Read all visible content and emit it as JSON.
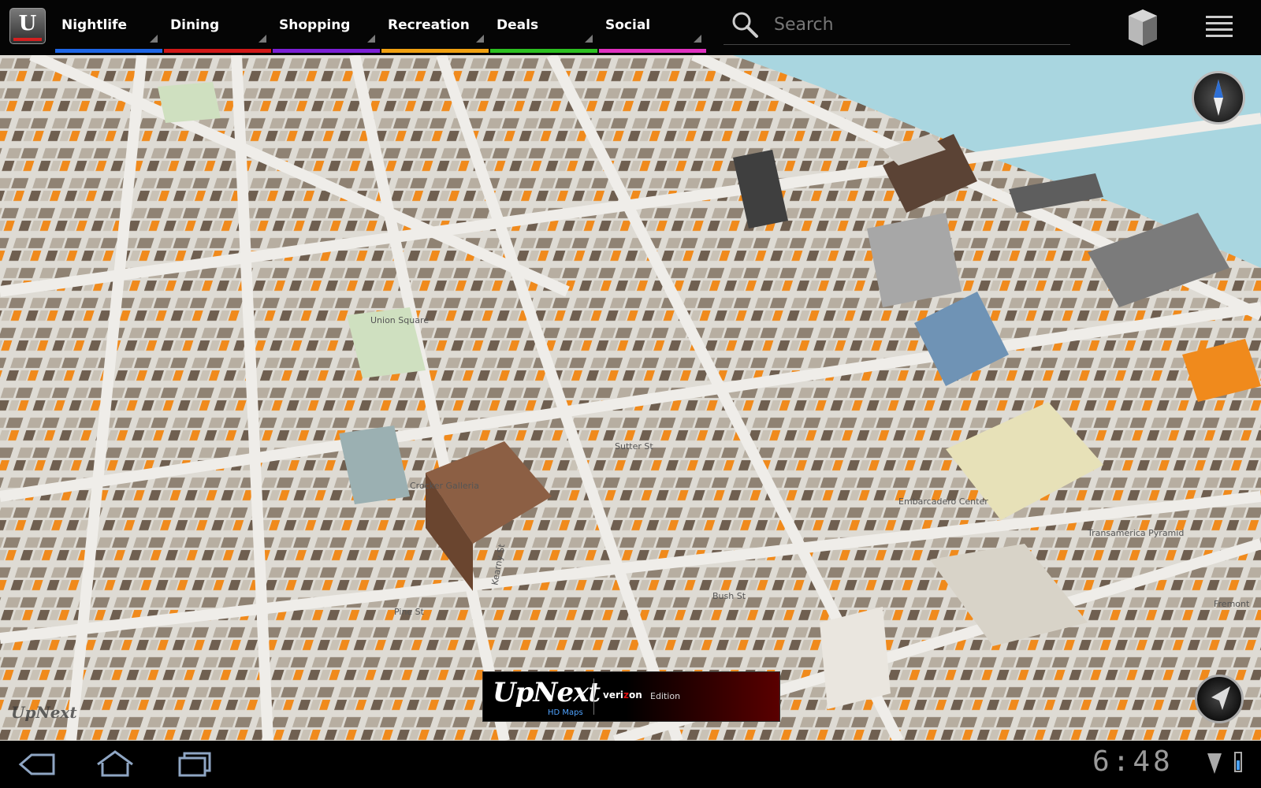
{
  "app": {
    "logo_letter": "U"
  },
  "categories": [
    {
      "label": "Nightlife",
      "color": "#1e66e6"
    },
    {
      "label": "Dining",
      "color": "#d11818"
    },
    {
      "label": "Shopping",
      "color": "#7b1fd6"
    },
    {
      "label": "Recreation",
      "color": "#f0a010"
    },
    {
      "label": "Deals",
      "color": "#2cc020"
    },
    {
      "label": "Social",
      "color": "#e030c0"
    }
  ],
  "search": {
    "placeholder": "Search"
  },
  "map": {
    "street_labels": [
      "Bush St",
      "Kearny St",
      "Pine St",
      "Sutter St",
      "Fremont"
    ],
    "place_labels": [
      "Crocker Galleria",
      "Union Square",
      "Embarcadero Center",
      "Transamerica Pyramid"
    ]
  },
  "banner": {
    "brand": "UpNext",
    "sub": "HD Maps",
    "carrier_prefix": "veri",
    "carrier_mark": "z",
    "carrier_suffix": "on",
    "edition": "Edition"
  },
  "watermark": "UpNext",
  "status_bar": {
    "time": "6:48"
  },
  "colors": {
    "water": "#a9d6e0",
    "road": "#c9c7c2",
    "highlight": "#f08a1c",
    "park": "#cfe0c0"
  }
}
